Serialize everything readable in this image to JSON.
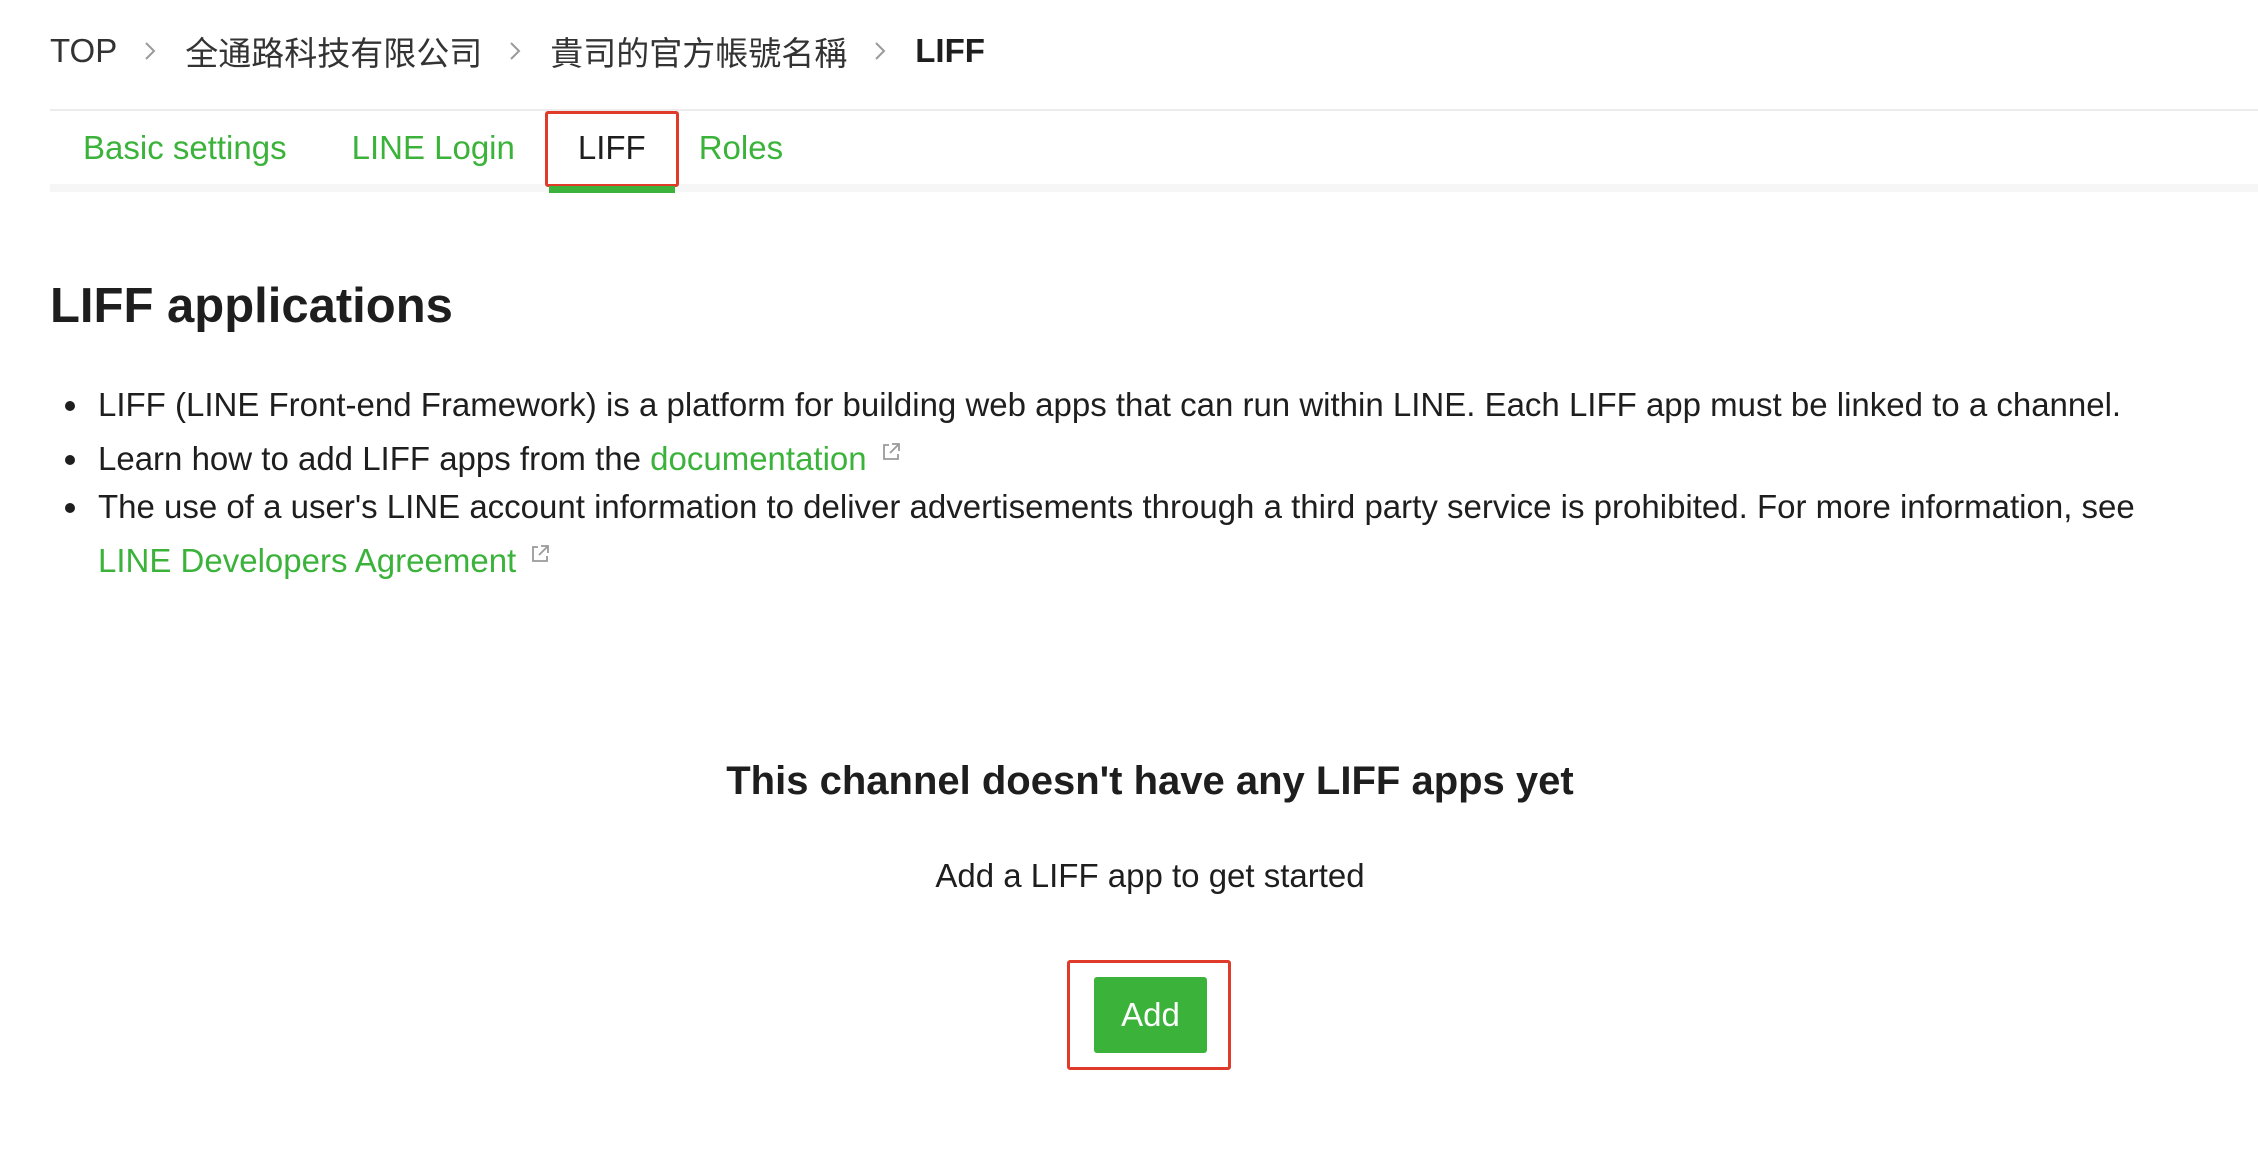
{
  "breadcrumb": {
    "items": [
      {
        "label": "TOP"
      },
      {
        "label": "全通路科技有限公司"
      },
      {
        "label": "貴司的官方帳號名稱"
      },
      {
        "label": "LIFF"
      }
    ]
  },
  "tabs": [
    {
      "label": "Basic settings"
    },
    {
      "label": "LINE Login"
    },
    {
      "label": "LIFF",
      "active": true
    },
    {
      "label": "Roles"
    }
  ],
  "main": {
    "heading": "LIFF applications",
    "bullet1": "LIFF (LINE Front-end Framework) is a platform for building web apps that can run within LINE. Each LIFF app must be linked to a channel.",
    "bullet2_prefix": "Learn how to add LIFF apps from the ",
    "bullet2_link": "documentation",
    "bullet3_prefix": "The use of a user's LINE account information to deliver advertisements through a third party service is prohibited. For more information, see ",
    "bullet3_link": "LINE Developers Agreement",
    "external_link_icon": "external-link-icon"
  },
  "empty_state": {
    "title": "This channel doesn't have any LIFF apps yet",
    "subtitle": "Add a LIFF app to get started",
    "add_button": "Add"
  },
  "colors": {
    "accent": "#3bb33b",
    "highlight": "#e03a2b",
    "text": "#1e1e1e"
  }
}
